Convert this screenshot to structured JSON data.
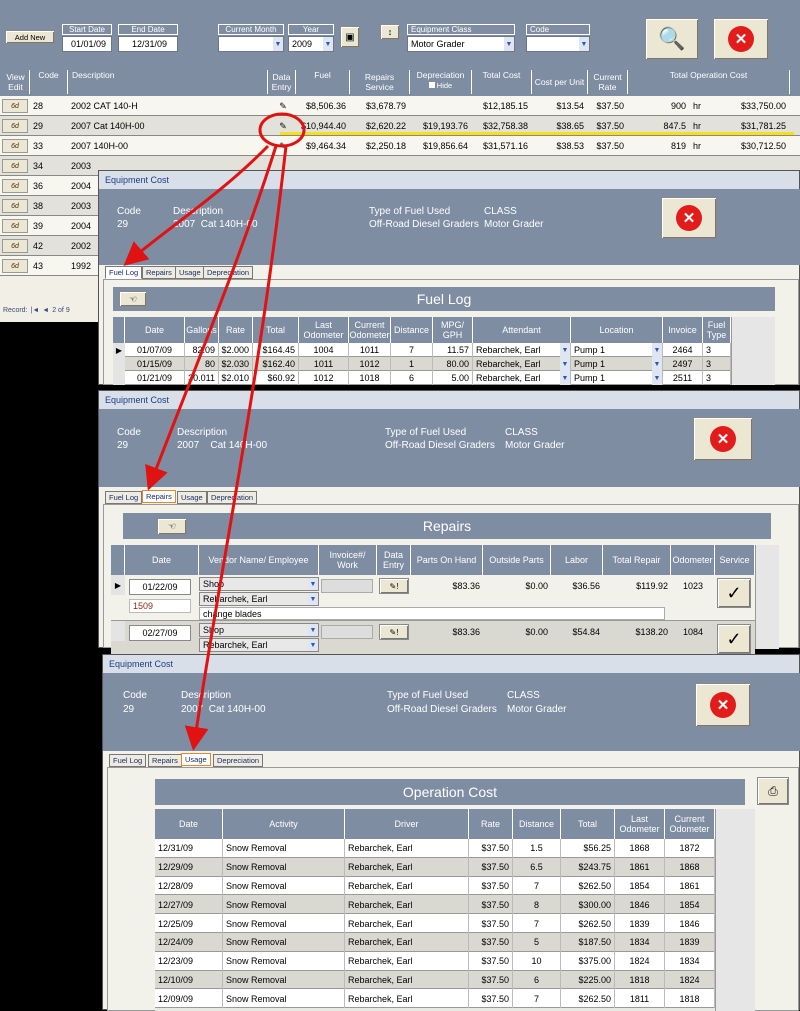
{
  "main": {
    "add_new": "Add New",
    "start_date_label": "Start Date",
    "start_date": "01/01/09",
    "end_date_label": "End Date",
    "end_date": "12/31/09",
    "current_month_label": "Current Month",
    "current_month": "",
    "year_label": "Year",
    "year": "2009",
    "equip_class_label": "Equipment Class",
    "equip_class": "Motor Grader",
    "code_label": "Code",
    "code": "",
    "headers": [
      "View Edit",
      "Code",
      "Description",
      "Data Entry",
      "Fuel",
      "Repairs Service",
      "Depreciation",
      "Total Cost",
      "Cost per Unit",
      "Current Rate",
      "Total Operation Cost"
    ],
    "hide_label": "Hide",
    "rows": [
      {
        "view": "6d",
        "code": "28",
        "desc": "2002  CAT 140-H",
        "fuel": "$8,506.36",
        "repairs": "$3,678.79",
        "dep": "",
        "total": "$12,185.15",
        "cpu": "$13.54",
        "rate": "$37.50",
        "hrs": "900",
        "unit": "hr",
        "op": "$33,750.00"
      },
      {
        "view": "6d",
        "code": "29",
        "desc": "2007  Cat 140H-00",
        "fuel": "$10,944.40",
        "repairs": "$2,620.22",
        "dep": "$19,193.76",
        "total": "$32,758.38",
        "cpu": "$38.65",
        "rate": "$37.50",
        "hrs": "847.5",
        "unit": "hr",
        "op": "$31,781.25"
      },
      {
        "view": "6d",
        "code": "33",
        "desc": "2007  140H-00",
        "fuel": "$9,464.34",
        "repairs": "$2,250.18",
        "dep": "$19,856.64",
        "total": "$31,571.16",
        "cpu": "$38.53",
        "rate": "$37.50",
        "hrs": "819",
        "unit": "hr",
        "op": "$30,712.50"
      },
      {
        "view": "6d",
        "code": "34",
        "desc": "2003",
        "fuel": "",
        "repairs": "",
        "dep": "",
        "total": "",
        "cpu": "",
        "rate": "",
        "hrs": "",
        "unit": "",
        "op": ""
      },
      {
        "view": "6d",
        "code": "36",
        "desc": "2004",
        "fuel": "",
        "repairs": "",
        "dep": "",
        "total": "",
        "cpu": "",
        "rate": "",
        "hrs": "",
        "unit": "",
        "op": ""
      },
      {
        "view": "6d",
        "code": "38",
        "desc": "2003",
        "fuel": "",
        "repairs": "",
        "dep": "",
        "total": "",
        "cpu": "",
        "rate": "",
        "hrs": "",
        "unit": "",
        "op": ""
      },
      {
        "view": "6d",
        "code": "39",
        "desc": "2004",
        "fuel": "",
        "repairs": "",
        "dep": "",
        "total": "",
        "cpu": "",
        "rate": "",
        "hrs": "",
        "unit": "",
        "op": ""
      },
      {
        "view": "6d",
        "code": "42",
        "desc": "2002",
        "fuel": "",
        "repairs": "",
        "dep": "",
        "total": "",
        "cpu": "",
        "rate": "",
        "hrs": "",
        "unit": "",
        "op": ""
      },
      {
        "view": "6d",
        "code": "43",
        "desc": "1992",
        "fuel": "",
        "repairs": "",
        "dep": "",
        "total": "",
        "cpu": "",
        "rate": "",
        "hrs": "",
        "unit": "",
        "op": ""
      }
    ],
    "record_label": "Record:",
    "record_pos": "2 of 9"
  },
  "window_title": "Equipment Cost",
  "header": {
    "code_label": "Code",
    "code": "29",
    "desc_label": "Description",
    "desc_w1": "2007  Cat 140H-00",
    "desc_w2": "2007    Cat 140H-00",
    "desc_w3": "2007  Cat 140H-00",
    "fuel_type_label": "Type of Fuel Used",
    "fuel_type": "Off-Road Diesel Graders",
    "class_label": "CLASS",
    "class_value": "Motor Grader"
  },
  "tabs": [
    "Fuel Log",
    "Repairs",
    "Usage",
    "Depreciation"
  ],
  "fuel_log": {
    "title": "Fuel Log",
    "headers": [
      "Date",
      "Gallons",
      "Rate",
      "Total",
      "Last Odometer",
      "Current Odometer",
      "Distance",
      "MPG/ GPH",
      "Attendant",
      "Location",
      "Invoice",
      "Fuel Type"
    ],
    "rows": [
      [
        "01/07/09",
        "82.09",
        "$2.000",
        "$164.45",
        "1004",
        "1011",
        "7",
        "11.57",
        "Rebarchek, Earl",
        "Pump 1",
        "2464",
        "3"
      ],
      [
        "01/15/09",
        "80",
        "$2.030",
        "$162.40",
        "1011",
        "1012",
        "1",
        "80.00",
        "Rebarchek, Earl",
        "Pump 1",
        "2497",
        "3"
      ],
      [
        "01/21/09",
        "30.011",
        "$2.010",
        "$60.92",
        "1012",
        "1018",
        "6",
        "5.00",
        "Rebarchek, Earl",
        "Pump 1",
        "2511",
        "3"
      ]
    ]
  },
  "repairs": {
    "title": "Repairs",
    "headers": [
      "Date",
      "Vendor Name/ Employee",
      "Invoice#/ Work",
      "Data Entry",
      "Parts On Hand",
      "Outside Parts",
      "Labor",
      "Total Repair",
      "Odometer",
      "Service"
    ],
    "rows": [
      {
        "date": "01/22/09",
        "vendor": "Shop",
        "employee": "Rebarchek, Earl",
        "work_no": "1509",
        "note": "change blades",
        "parts": "$83.36",
        "outside": "$0.00",
        "labor": "$36.56",
        "total": "$119.92",
        "odo": "1023",
        "service": "✓"
      },
      {
        "date": "02/27/09",
        "vendor": "Shop",
        "employee": "Rebarchek, Earl",
        "work_no": "",
        "note": "",
        "parts": "$83.36",
        "outside": "$0.00",
        "labor": "$54.84",
        "total": "$138.20",
        "odo": "1084",
        "service": "✓"
      }
    ]
  },
  "usage": {
    "title": "Operation Cost",
    "headers": [
      "Date",
      "Activity",
      "Driver",
      "Rate",
      "Distance",
      "Total",
      "Last Odometer",
      "Current Odometer"
    ],
    "rows": [
      [
        "12/31/09",
        "Snow Removal",
        "Rebarchek, Earl",
        "$37.50",
        "1.5",
        "$56.25",
        "1868",
        "1872"
      ],
      [
        "12/29/09",
        "Snow Removal",
        "Rebarchek, Earl",
        "$37.50",
        "6.5",
        "$243.75",
        "1861",
        "1868"
      ],
      [
        "12/28/09",
        "Snow Removal",
        "Rebarchek, Earl",
        "$37.50",
        "7",
        "$262.50",
        "1854",
        "1861"
      ],
      [
        "12/27/09",
        "Snow Removal",
        "Rebarchek, Earl",
        "$37.50",
        "8",
        "$300.00",
        "1846",
        "1854"
      ],
      [
        "12/25/09",
        "Snow Removal",
        "Rebarchek, Earl",
        "$37.50",
        "7",
        "$262.50",
        "1839",
        "1846"
      ],
      [
        "12/24/09",
        "Snow Removal",
        "Rebarchek, Earl",
        "$37.50",
        "5",
        "$187.50",
        "1834",
        "1839"
      ],
      [
        "12/23/09",
        "Snow Removal",
        "Rebarchek, Earl",
        "$37.50",
        "10",
        "$375.00",
        "1824",
        "1834"
      ],
      [
        "12/10/09",
        "Snow Removal",
        "Rebarchek, Earl",
        "$37.50",
        "6",
        "$225.00",
        "1818",
        "1824"
      ],
      [
        "12/09/09",
        "Snow Removal",
        "Rebarchek, Earl",
        "$37.50",
        "7",
        "$262.50",
        "1811",
        "1818"
      ]
    ]
  },
  "colors": {
    "header_bg": "#7f8da3",
    "highlight": "#f5e11a",
    "arrow": "#e11212"
  }
}
